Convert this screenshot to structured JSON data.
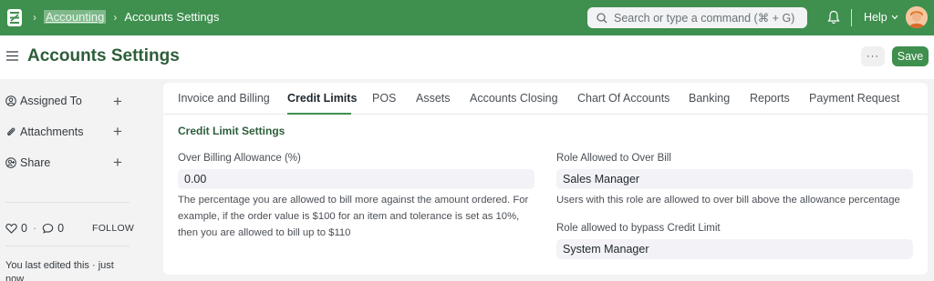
{
  "navbar": {
    "breadcrumbs": [
      "Accounting",
      "Accounts Settings"
    ],
    "search_placeholder": "Search or type a command (⌘ + G)",
    "help_label": "Help"
  },
  "page": {
    "title": "Accounts Settings",
    "more_label": "···",
    "save_label": "Save"
  },
  "sidebar": {
    "assigned_to": "Assigned To",
    "attachments": "Attachments",
    "share": "Share",
    "likes_count": "0",
    "comments_count": "0",
    "follow_label": "FOLLOW",
    "last_edited": "You last edited this · just now"
  },
  "tabs": [
    {
      "label": "Invoice and Billing"
    },
    {
      "label": "Credit Limits",
      "active": true
    },
    {
      "label": "POS"
    },
    {
      "label": "Assets"
    },
    {
      "label": "Accounts Closing"
    },
    {
      "label": "Chart Of Accounts"
    },
    {
      "label": "Banking"
    },
    {
      "label": "Reports"
    },
    {
      "label": "Payment Request"
    }
  ],
  "form": {
    "section_title": "Credit Limit Settings",
    "over_billing_label": "Over Billing Allowance (%)",
    "over_billing_value": "0.00",
    "over_billing_help": [
      "The percentage you are allowed to bill more against the amount ordered. For",
      "example, if the order value is $100 for an item and tolerance is set as 10%,",
      "then you are allowed to bill up to $110"
    ],
    "role_over_bill_label": "Role Allowed to Over Bill",
    "role_over_bill_value": "Sales Manager",
    "role_over_bill_help": "Users with this role are allowed to over bill above the allowance percentage",
    "role_bypass_label": "Role allowed to bypass Credit Limit",
    "role_bypass_value": "System Manager"
  },
  "colors": {
    "navbar": "#3f8f4f",
    "accent": "#2d5e3a",
    "save_button": "#3f8f4f"
  }
}
